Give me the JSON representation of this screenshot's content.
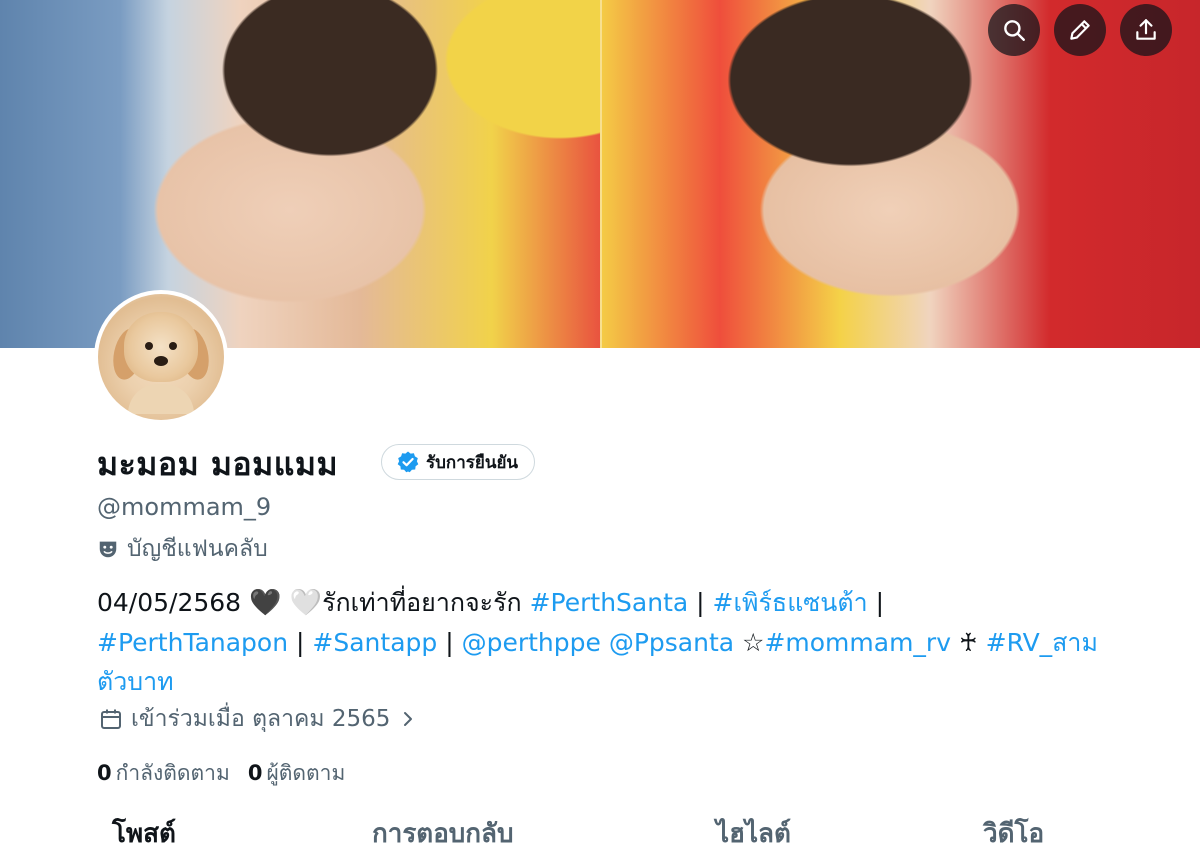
{
  "header": {
    "search_icon": "search-icon",
    "edit_icon": "pencil-icon",
    "share_icon": "share-icon"
  },
  "profile": {
    "display_name": "มะมอม มอมแมม",
    "verified_label": "รับการยืนยัน",
    "handle": "@mommam_9",
    "affiliation": "บัญชีแฟนคลับ",
    "bio": {
      "date": "04/05/2568",
      "hearts": "🖤 🤍",
      "text": "รักเท่าที่อยากจะรัก",
      "tag_perthsanta": "#PerthSanta",
      "sep1": " | ",
      "tag_thai": "#เพิร์ธแซนต้า",
      "sep2": " |",
      "tag_perthtanapon": "#PerthTanapon",
      "sep3": " | ",
      "tag_santapp": "#Santapp",
      "sep4": " | ",
      "mention_perthppe": "@perthppe",
      "mention_ppsanta": "@Ppsanta",
      "star": " ☆",
      "tag_mommam_rv": "#mommam_rv",
      "cross": " ♰ ",
      "tag_rv": "#RV_สามตัวบาท"
    },
    "joined": "เข้าร่วมเมื่อ ตุลาคม 2565",
    "following_count": "0",
    "following_label": "กำลังติดตาม",
    "followers_count": "0",
    "followers_label": "ผู้ติดตาม"
  },
  "tabs": [
    {
      "label": "โพสต์",
      "active": true
    },
    {
      "label": "การตอบกลับ",
      "active": false
    },
    {
      "label": "ไฮไลต์",
      "active": false
    },
    {
      "label": "วิดีโอ",
      "active": false
    }
  ],
  "colors": {
    "accent": "#1d9bf0",
    "secondary_text": "#536471",
    "primary_text": "#0f1419"
  }
}
